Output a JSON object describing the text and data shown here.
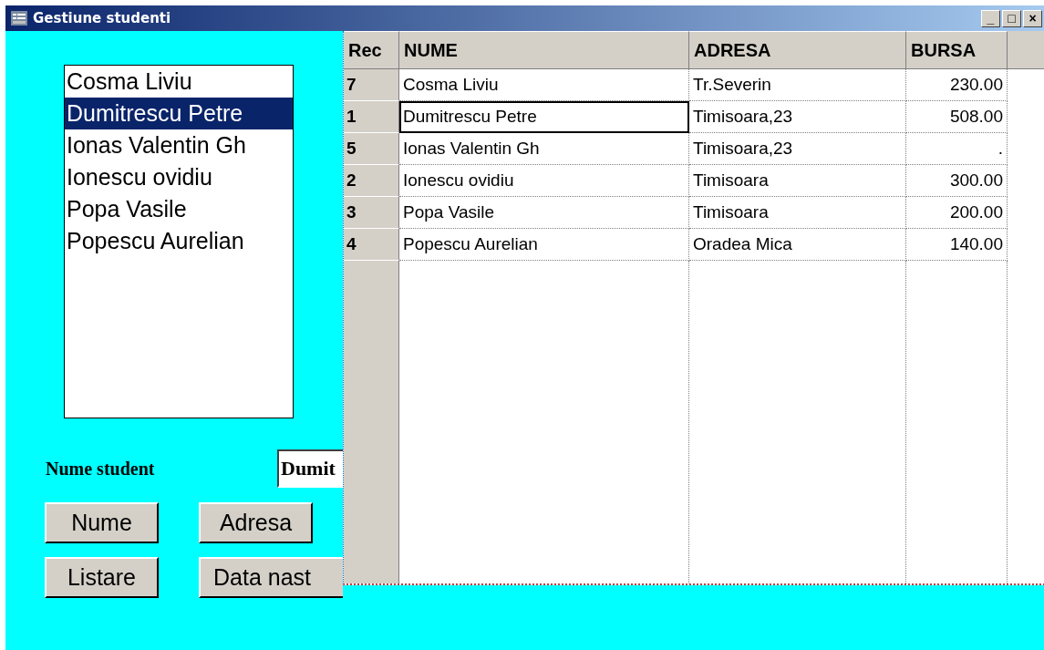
{
  "window": {
    "title": "Gestiune studenti",
    "controls": [
      "_",
      "□",
      "×"
    ]
  },
  "listbox": {
    "items": [
      {
        "label": "Cosma Liviu",
        "selected": false
      },
      {
        "label": "Dumitrescu Petre",
        "selected": true
      },
      {
        "label": "Ionas Valentin Gh",
        "selected": false
      },
      {
        "label": "Ionescu ovidiu",
        "selected": false
      },
      {
        "label": "Popa Vasile",
        "selected": false
      },
      {
        "label": "Popescu Aurelian",
        "selected": false
      }
    ]
  },
  "name_field": {
    "label": "Nume student",
    "value": "Dumit"
  },
  "buttons": [
    "Nume",
    "Adresa",
    "Listare",
    "Data nast"
  ],
  "grid": {
    "columns": [
      "Rec",
      "NUME",
      "ADRESA",
      "BURSA"
    ],
    "rows": [
      {
        "cells": [
          "7",
          "Cosma Liviu",
          "Tr.Severin",
          "230.00"
        ],
        "selected": false
      },
      {
        "cells": [
          "1",
          "Dumitrescu Petre",
          "Timisoara,23",
          "508.00"
        ],
        "selected": true
      },
      {
        "cells": [
          "5",
          "Ionas Valentin Gh",
          "Timisoara,23",
          "."
        ],
        "selected": false
      },
      {
        "cells": [
          "2",
          "Ionescu ovidiu",
          "Timisoara",
          "300.00"
        ],
        "selected": false
      },
      {
        "cells": [
          "3",
          "Popa Vasile",
          "Timisoara",
          "200.00"
        ],
        "selected": false
      },
      {
        "cells": [
          "4",
          "Popescu Aurelian",
          "Oradea Mica",
          "140.00"
        ],
        "selected": false
      }
    ]
  }
}
